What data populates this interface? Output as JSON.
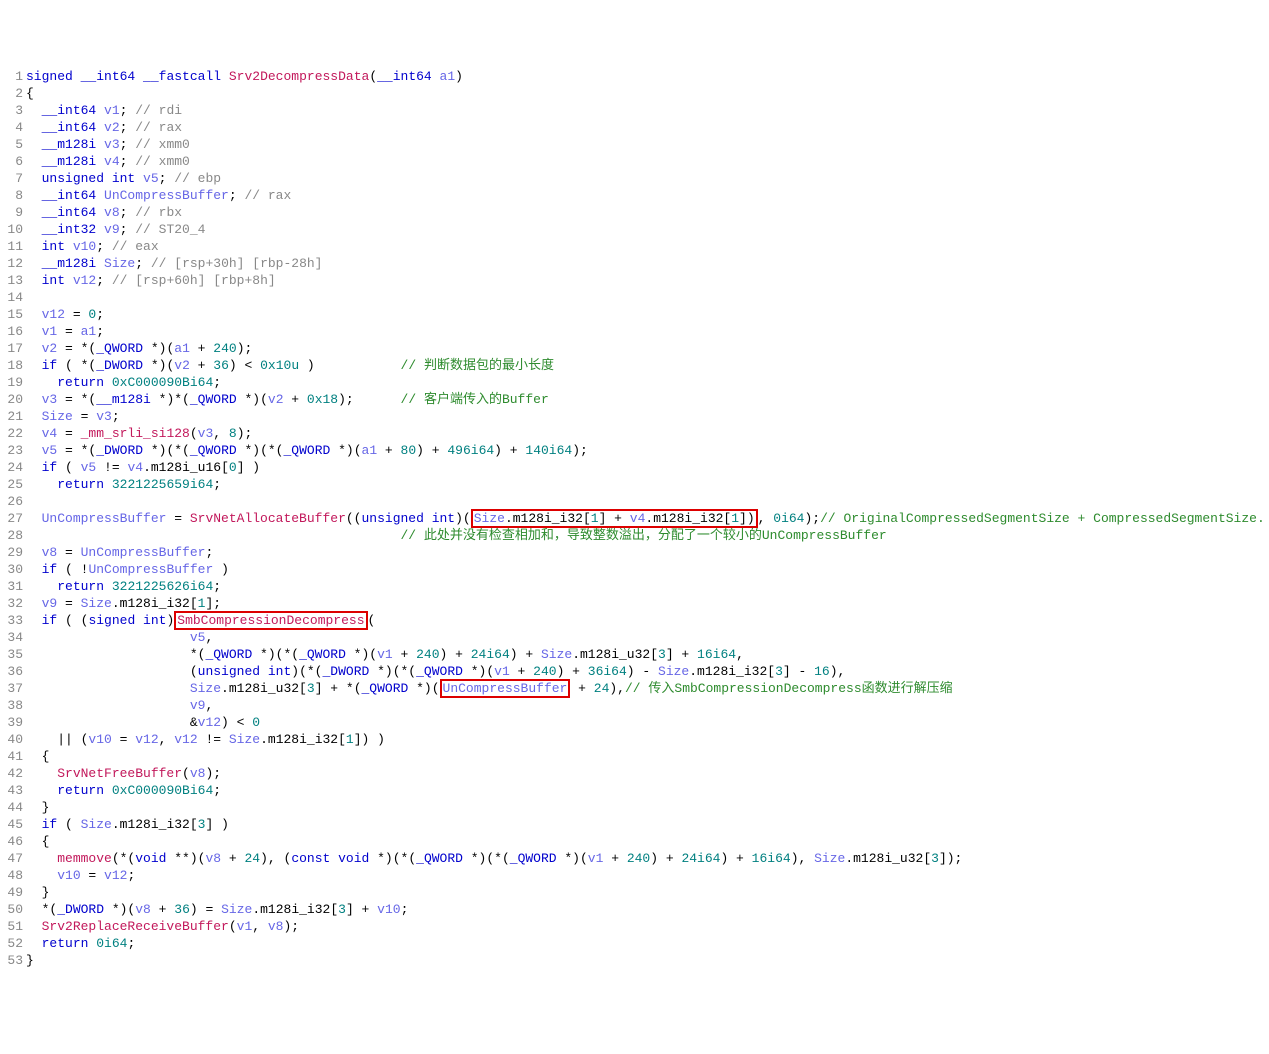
{
  "lines": [
    {
      "n": "1",
      "code": "<span class='kw'>signed</span> <span class='kw'>__int64</span> <span class='kw'>__fastcall</span> <span class='fn'>Srv2DecompressData</span>(<span class='kw'>__int64</span> <span class='parm'>a1</span>)"
    },
    {
      "n": "2",
      "code": "{"
    },
    {
      "n": "3",
      "code": "  <span class='kw'>__int64</span> <span class='id'>v1</span>; <span class='cmg'>// rdi</span>"
    },
    {
      "n": "4",
      "code": "  <span class='kw'>__int64</span> <span class='id'>v2</span>; <span class='cmg'>// rax</span>"
    },
    {
      "n": "5",
      "code": "  <span class='kw'>__m128i</span> <span class='id'>v3</span>; <span class='cmg'>// xmm0</span>"
    },
    {
      "n": "6",
      "code": "  <span class='kw'>__m128i</span> <span class='id'>v4</span>; <span class='cmg'>// xmm0</span>"
    },
    {
      "n": "7",
      "code": "  <span class='kw'>unsigned int</span> <span class='id'>v5</span>; <span class='cmg'>// ebp</span>"
    },
    {
      "n": "8",
      "code": "  <span class='kw'>__int64</span> <span class='id'>UnCompressBuffer</span>; <span class='cmg'>// rax</span>"
    },
    {
      "n": "9",
      "code": "  <span class='kw'>__int64</span> <span class='id'>v8</span>; <span class='cmg'>// rbx</span>"
    },
    {
      "n": "10",
      "code": "  <span class='kw'>__int32</span> <span class='id'>v9</span>; <span class='cmg'>// ST20_4</span>"
    },
    {
      "n": "11",
      "code": "  <span class='kw'>int</span> <span class='id'>v10</span>; <span class='cmg'>// eax</span>"
    },
    {
      "n": "12",
      "code": "  <span class='kw'>__m128i</span> <span class='id'>Size</span>; <span class='cmg'>// [rsp+30h] [rbp-28h]</span>"
    },
    {
      "n": "13",
      "code": "  <span class='kw'>int</span> <span class='id'>v12</span>; <span class='cmg'>// [rsp+60h] [rbp+8h]</span>"
    },
    {
      "n": "14",
      "code": ""
    },
    {
      "n": "15",
      "code": "  <span class='id'>v12</span> = <span class='num'>0</span>;"
    },
    {
      "n": "16",
      "code": "  <span class='id'>v1</span> = <span class='id'>a1</span>;"
    },
    {
      "n": "17",
      "code": "  <span class='id'>v2</span> = *(<span class='kw'>_QWORD</span> *)(<span class='id'>a1</span> + <span class='num'>240</span>);"
    },
    {
      "n": "18",
      "code": "  <span class='kw'>if</span> ( *(<span class='kw'>_DWORD</span> *)(<span class='id'>v2</span> + <span class='num'>36</span>) &lt; <span class='num'>0x10u</span> )           <span class='cm'>// 判断数据包的最小长度</span>"
    },
    {
      "n": "19",
      "code": "    <span class='kw'>return</span> <span class='num'>0xC000090Bi64</span>;"
    },
    {
      "n": "20",
      "code": "  <span class='id'>v3</span> = *(<span class='kw'>__m128i</span> *)*(<span class='kw'>_QWORD</span> *)(<span class='id'>v2</span> + <span class='num'>0x18</span>);      <span class='cm'>// 客户端传入的Buffer</span>"
    },
    {
      "n": "21",
      "code": "  <span class='id'>Size</span> = <span class='id'>v3</span>;"
    },
    {
      "n": "22",
      "code": "  <span class='id'>v4</span> = <span class='fn'>_mm_srli_si128</span>(<span class='id'>v3</span>, <span class='num'>8</span>);"
    },
    {
      "n": "23",
      "code": "  <span class='id'>v5</span> = *(<span class='kw'>_DWORD</span> *)(*(<span class='kw'>_QWORD</span> *)(*(<span class='kw'>_QWORD</span> *)(<span class='id'>a1</span> + <span class='num'>80</span>) + <span class='num'>496i64</span>) + <span class='num'>140i64</span>);"
    },
    {
      "n": "24",
      "code": "  <span class='kw'>if</span> ( <span class='id'>v5</span> != <span class='id'>v4</span>.m128i_u16[<span class='num'>0</span>] )"
    },
    {
      "n": "25",
      "code": "    <span class='kw'>return</span> <span class='num'>3221225659i64</span>;"
    },
    {
      "n": "26",
      "code": ""
    },
    {
      "n": "27",
      "code": "  <span class='id'>UnCompressBuffer</span> = <span class='fn'>SrvNetAllocateBuffer</span>((<span class='kw'>unsigned int</span>)(<span class='hl'><span class='id'>Size</span>.m128i_i32[<span class='num'>1</span>] + <span class='id'>v4</span>.m128i_i32[<span class='num'>1</span>])</span>, <span class='num'>0i64</span>);<span class='cm'>// OriginalCompressedSegmentSize + CompressedSegmentSize.</span>"
    },
    {
      "n": "28",
      "code": "                                                <span class='cm'>// 此处并没有检查相加和，导致整数溢出，分配了一个较小的UnCompressBuffer</span>"
    },
    {
      "n": "29",
      "code": "  <span class='id'>v8</span> = <span class='id'>UnCompressBuffer</span>;"
    },
    {
      "n": "30",
      "code": "  <span class='kw'>if</span> ( !<span class='id'>UnCompressBuffer</span> )"
    },
    {
      "n": "31",
      "code": "    <span class='kw'>return</span> <span class='num'>3221225626i64</span>;"
    },
    {
      "n": "32",
      "code": "  <span class='id'>v9</span> = <span class='id'>Size</span>.m128i_i32[<span class='num'>1</span>];"
    },
    {
      "n": "33",
      "code": "  <span class='kw'>if</span> ( (<span class='kw'>signed int</span>)<span class='hl'><span class='fn'>SmbCompressionDecompress</span></span>("
    },
    {
      "n": "34",
      "code": "                     <span class='id'>v5</span>,"
    },
    {
      "n": "35",
      "code": "                     *(<span class='kw'>_QWORD</span> *)(*(<span class='kw'>_QWORD</span> *)(<span class='id'>v1</span> + <span class='num'>240</span>) + <span class='num'>24i64</span>) + <span class='id'>Size</span>.m128i_u32[<span class='num'>3</span>] + <span class='num'>16i64</span>,"
    },
    {
      "n": "36",
      "code": "                     (<span class='kw'>unsigned int</span>)(*(<span class='kw'>_DWORD</span> *)(*(<span class='kw'>_QWORD</span> *)(<span class='id'>v1</span> + <span class='num'>240</span>) + <span class='num'>36i64</span>) - <span class='id'>Size</span>.m128i_i32[<span class='num'>3</span>] - <span class='num'>16</span>),"
    },
    {
      "n": "37",
      "code": "                     <span class='id'>Size</span>.m128i_u32[<span class='num'>3</span>] + *(<span class='kw'>_QWORD</span> *)(<span class='hl'><span class='id'>UnCompressBuffer</span></span> + <span class='num'>24</span>),<span class='cm'>// 传入SmbCompressionDecompress函数进行解压缩</span>"
    },
    {
      "n": "38",
      "code": "                     <span class='id'>v9</span>,"
    },
    {
      "n": "39",
      "code": "                     &amp;<span class='id'>v12</span>) &lt; <span class='num'>0</span>"
    },
    {
      "n": "40",
      "code": "    || (<span class='id'>v10</span> = <span class='id'>v12</span>, <span class='id'>v12</span> != <span class='id'>Size</span>.m128i_i32[<span class='num'>1</span>]) )"
    },
    {
      "n": "41",
      "code": "  {"
    },
    {
      "n": "42",
      "code": "    <span class='fn'>SrvNetFreeBuffer</span>(<span class='id'>v8</span>);"
    },
    {
      "n": "43",
      "code": "    <span class='kw'>return</span> <span class='num'>0xC000090Bi64</span>;"
    },
    {
      "n": "44",
      "code": "  }"
    },
    {
      "n": "45",
      "code": "  <span class='kw'>if</span> ( <span class='id'>Size</span>.m128i_i32[<span class='num'>3</span>] )"
    },
    {
      "n": "46",
      "code": "  {"
    },
    {
      "n": "47",
      "code": "    <span class='fn'>memmove</span>(*(<span class='kw'>void</span> **)(<span class='id'>v8</span> + <span class='num'>24</span>), (<span class='kw'>const void</span> *)(*(<span class='kw'>_QWORD</span> *)(*(<span class='kw'>_QWORD</span> *)(<span class='id'>v1</span> + <span class='num'>240</span>) + <span class='num'>24i64</span>) + <span class='num'>16i64</span>), <span class='id'>Size</span>.m128i_u32[<span class='num'>3</span>]);"
    },
    {
      "n": "48",
      "code": "    <span class='id'>v10</span> = <span class='id'>v12</span>;"
    },
    {
      "n": "49",
      "code": "  }"
    },
    {
      "n": "50",
      "code": "  *(<span class='kw'>_DWORD</span> *)(<span class='id'>v8</span> + <span class='num'>36</span>) = <span class='id'>Size</span>.m128i_i32[<span class='num'>3</span>] + <span class='id'>v10</span>;"
    },
    {
      "n": "51",
      "code": "  <span class='fn'>Srv2ReplaceReceiveBuffer</span>(<span class='id'>v1</span>, <span class='id'>v8</span>);"
    },
    {
      "n": "52",
      "code": "  <span class='kw'>return</span> <span class='num'>0i64</span>;"
    },
    {
      "n": "53",
      "code": "}"
    }
  ]
}
